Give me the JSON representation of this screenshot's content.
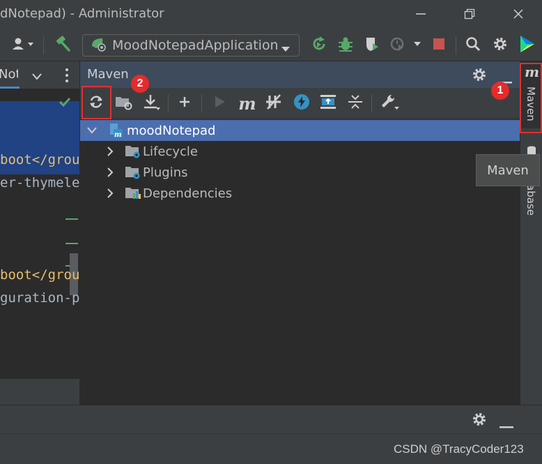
{
  "window": {
    "title": "dNotepad) - Administrator"
  },
  "toolbar": {
    "run_configuration": "MoodNotepadApplication"
  },
  "editor": {
    "tab_text": "Note",
    "lines": [
      {
        "text": "boot</grou"
      },
      {
        "text": "er-thymele"
      },
      {
        "text": "boot</grou"
      },
      {
        "text": "guration-p"
      }
    ]
  },
  "maven_panel": {
    "title": "Maven",
    "tree": {
      "root": "moodNotepad",
      "children": [
        "Lifecycle",
        "Plugins",
        "Dependencies"
      ]
    }
  },
  "right_strip": {
    "maven_tab": "Maven",
    "database_tab": "abase"
  },
  "tooltip": {
    "text": "Maven"
  },
  "annotations": {
    "badge1": "1",
    "badge2": "2"
  },
  "watermark": "CSDN @TracyCoder123",
  "colors": {
    "selection": "#4b6eaf",
    "highlight_red": "#e03030",
    "green": "#59a869"
  }
}
